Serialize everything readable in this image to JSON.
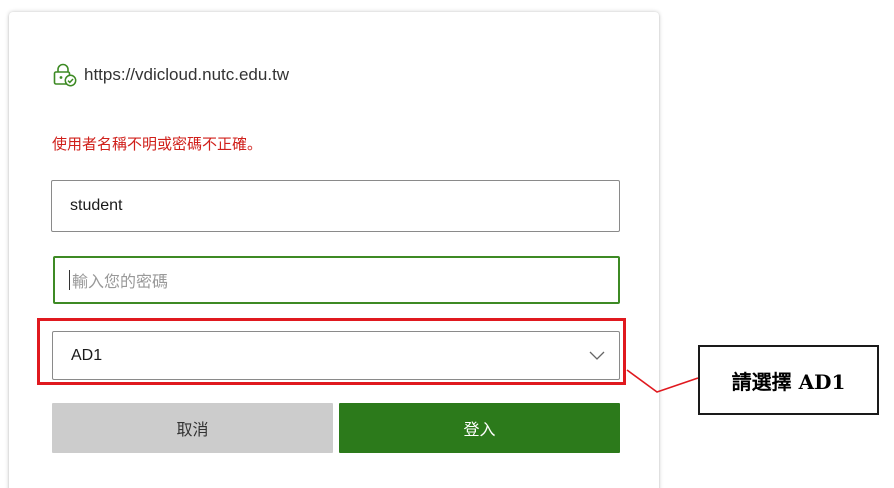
{
  "site": {
    "url": "https://vdicloud.nutc.edu.tw",
    "lock_icon": "secure-lock-check-icon"
  },
  "login": {
    "error_message": "使用者名稱不明或密碼不正確。",
    "username_value": "student",
    "password_placeholder": "輸入您的密碼",
    "domain_selected": "AD1",
    "cancel_label": "取消",
    "login_label": "登入"
  },
  "annotation": {
    "callout_text": "請選擇 AD1"
  },
  "colors": {
    "error": "#d0201b",
    "primary": "#2c7a1b",
    "focus_border": "#3d8a24",
    "highlight": "#e0191f",
    "cancel_bg": "#cccccc"
  }
}
